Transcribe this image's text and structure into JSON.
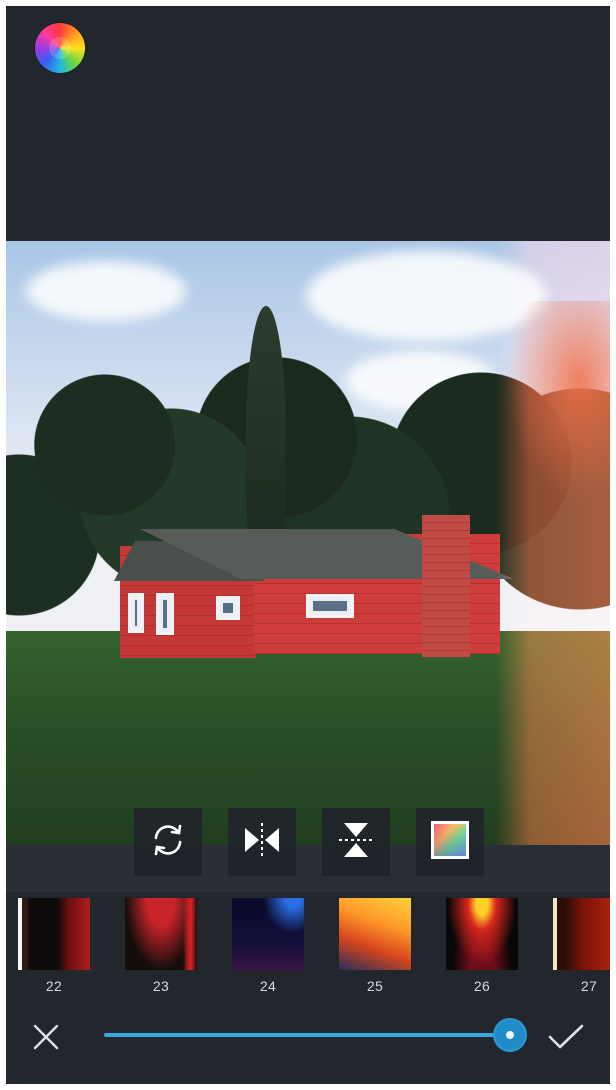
{
  "app": {
    "logo_icon": "color-wheel-icon"
  },
  "tools": [
    {
      "name": "rotate",
      "icon": "rotate-icon"
    },
    {
      "name": "flip-horizontal",
      "icon": "flip-horizontal-icon"
    },
    {
      "name": "flip-vertical",
      "icon": "flip-vertical-icon"
    },
    {
      "name": "color-overlay",
      "icon": "gradient-swatch-icon"
    }
  ],
  "filters": {
    "items": [
      {
        "label": "22"
      },
      {
        "label": "23"
      },
      {
        "label": "24"
      },
      {
        "label": "25"
      },
      {
        "label": "26"
      },
      {
        "label": "27"
      }
    ]
  },
  "bottom_bar": {
    "cancel_icon": "close-icon",
    "apply_icon": "checkmark-icon",
    "intensity_slider": {
      "value": 100,
      "max": 100
    }
  },
  "colors": {
    "background": "#22272e",
    "accent": "#3aa6e0",
    "text": "#d6dade"
  }
}
